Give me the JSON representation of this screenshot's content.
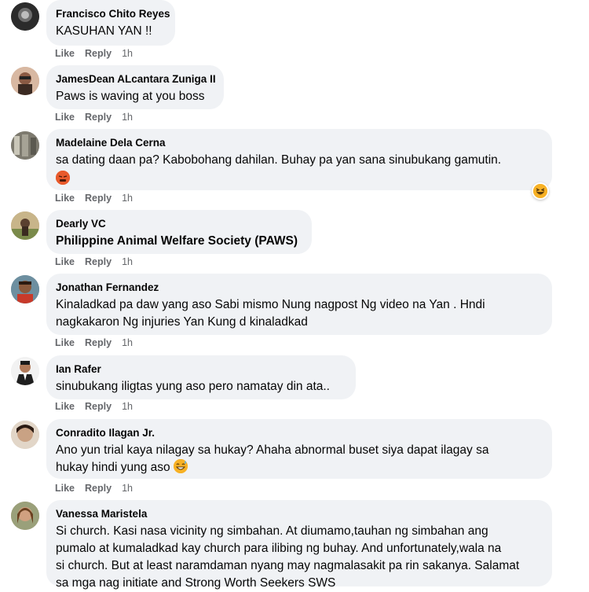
{
  "actions": {
    "like": "Like",
    "reply": "Reply"
  },
  "comments": [
    {
      "name": "Francisco Chito Reyes",
      "lines": [
        "KASUHAN YAN !!"
      ],
      "time": "1h"
    },
    {
      "name": "JamesDean ALcantara Zuniga II",
      "lines": [
        "Paws is waving at you boss"
      ],
      "time": "1h"
    },
    {
      "name": "Madelaine Dela Cerna",
      "lines": [
        "sa dating daan pa? Kabobohang dahilan. Buhay pa yan sana sinubukang gamutin."
      ],
      "emoji": "angry-face-emoji",
      "reaction": "laughing-reaction-icon",
      "time": "1h"
    },
    {
      "name": "Dearly VC",
      "lines": [
        "Philippine Animal Welfare Society (PAWS)"
      ],
      "time": "1h"
    },
    {
      "name": "Jonathan Fernandez",
      "lines": [
        "Kinaladkad pa daw yang aso Sabi mismo Nung nagpost Ng video na Yan . Hndi",
        "nagkakaron Ng injuries Yan Kung d kinaladkad"
      ],
      "time": "1h"
    },
    {
      "name": "Ian Rafer",
      "lines": [
        "sinubukang iligtas yung aso pero namatay din ata.."
      ],
      "time": "1h"
    },
    {
      "name": "Conradito Ilagan Jr.",
      "lines": [
        "Ano yun trial kaya nilagay sa hukay? Ahaha abnormal buset siya dapat ilagay sa",
        "hukay hindi yung aso"
      ],
      "emoji2": "grinning-sweat-emoji",
      "time": "1h"
    },
    {
      "name": "Vanessa Maristela",
      "lines": [
        "Si church. Kasi nasa vicinity ng simbahan. At diumamo,tauhan ng simbahan ang",
        "pumalo at kumaladkad kay church para ilibing ng buhay. And unfortunately,wala na",
        "si church. But at least naramdaman nyang may nagmalasakit pa rin sakanya. Salamat",
        "sa mga nag initiate and Strong Worth Seekers SWS"
      ]
    }
  ]
}
